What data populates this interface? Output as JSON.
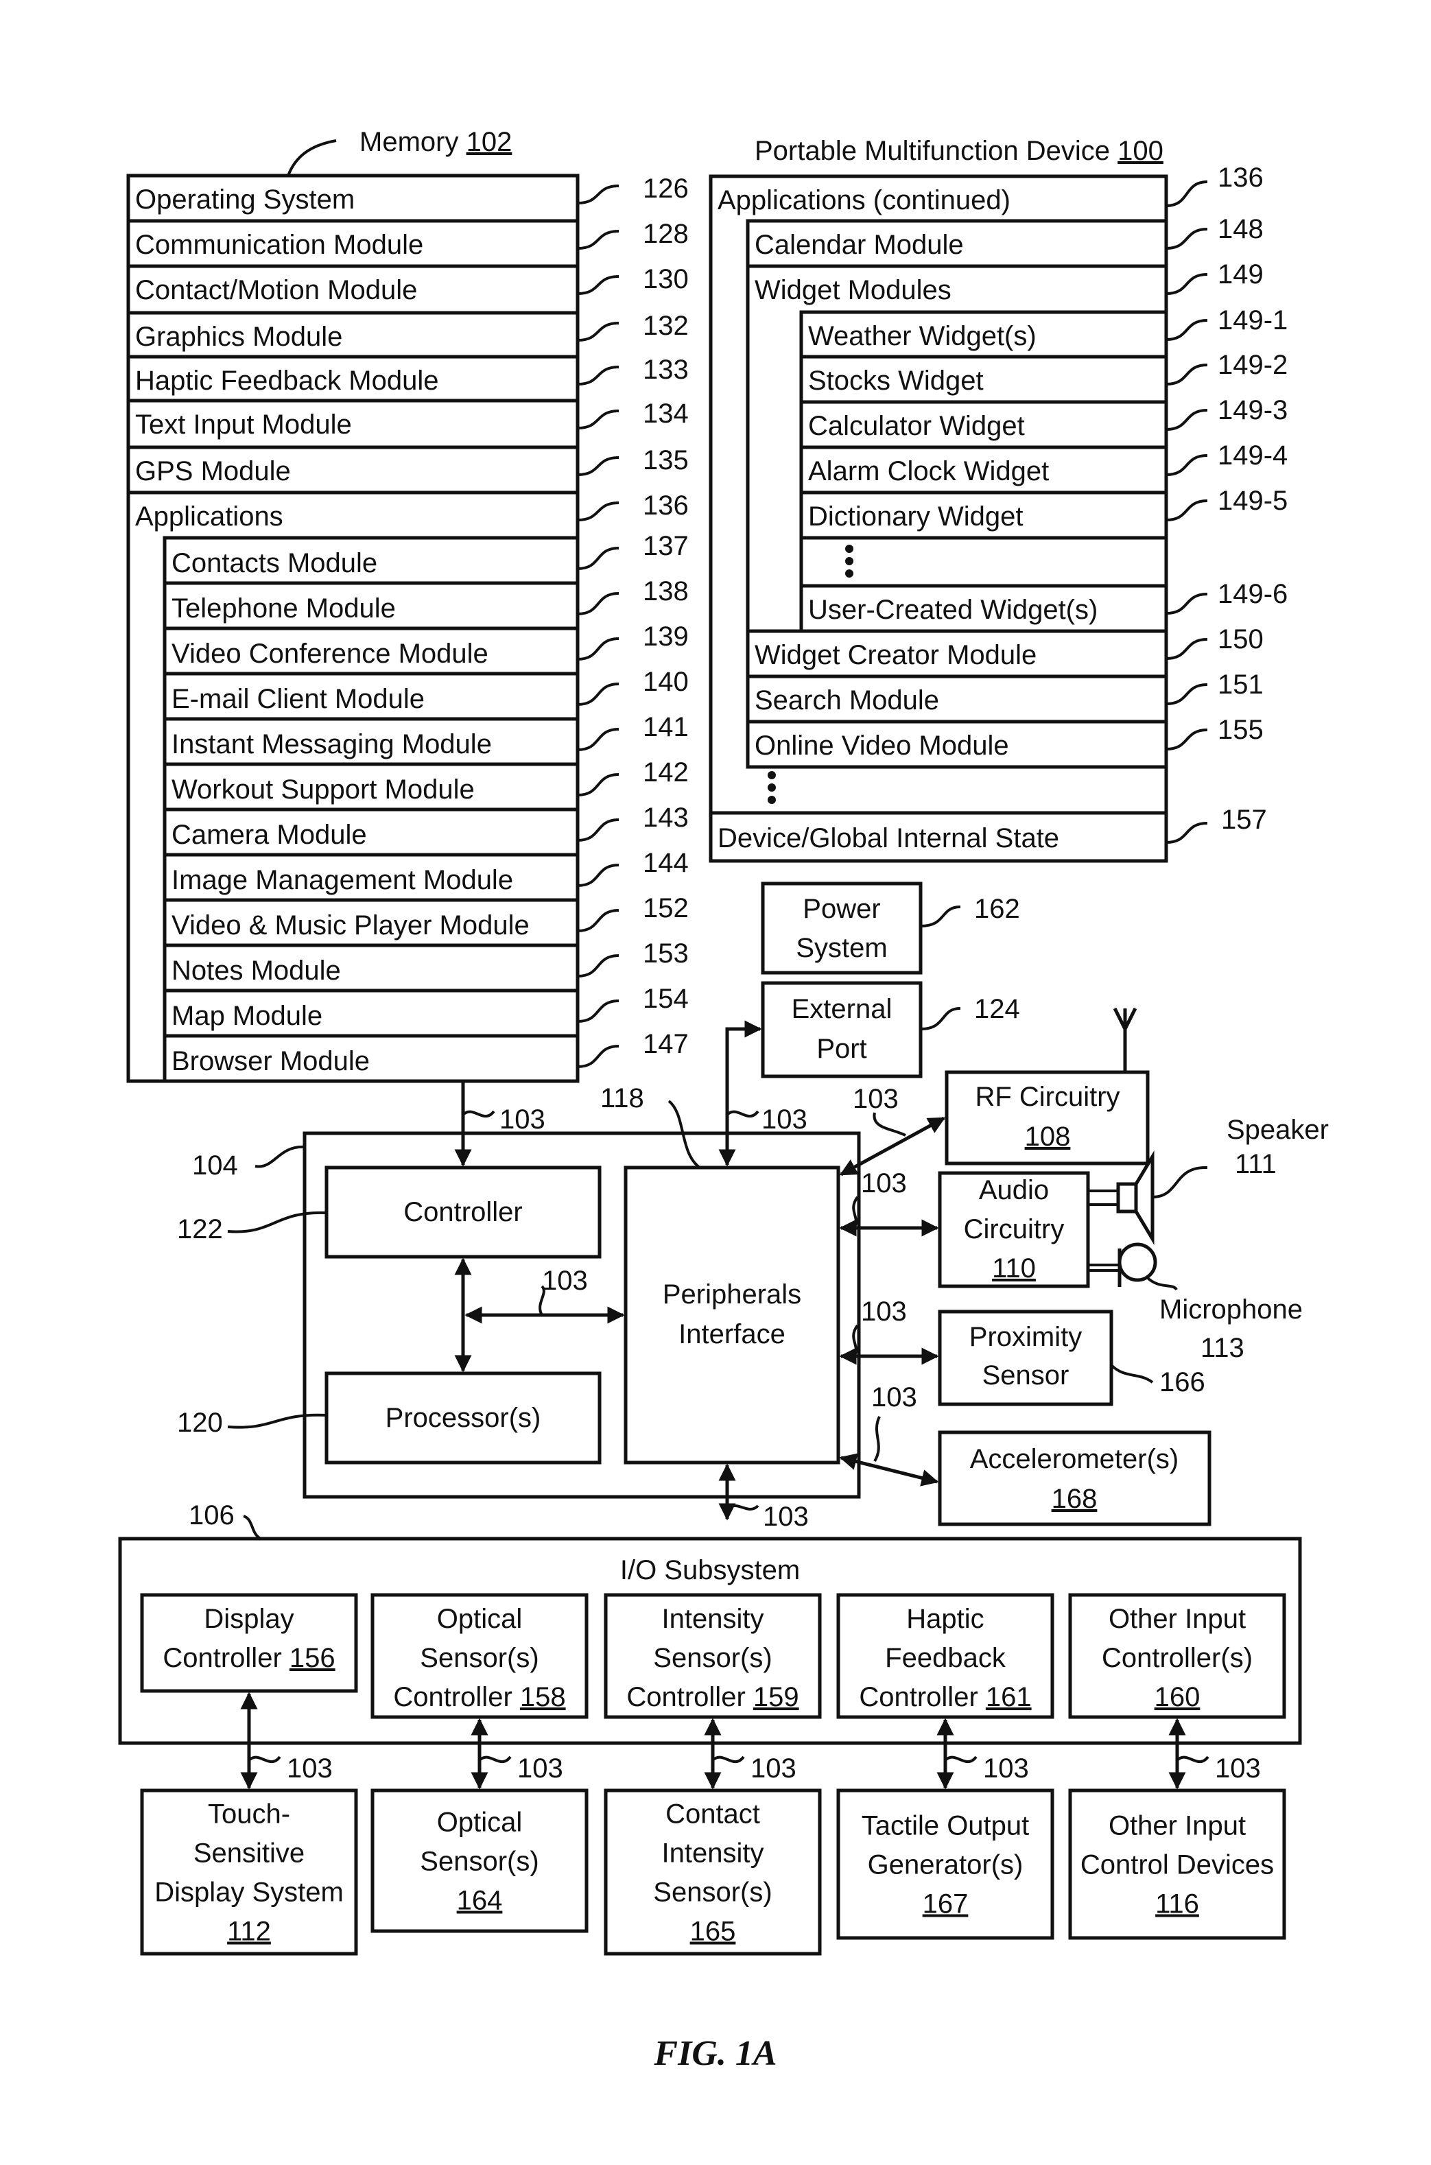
{
  "figure_caption": "FIG. 1A",
  "memory": {
    "title": "Memory",
    "title_ref": "102",
    "items": [
      {
        "label": "Operating System",
        "ref": "126"
      },
      {
        "label": "Communication Module",
        "ref": "128"
      },
      {
        "label": "Contact/Motion Module",
        "ref": "130"
      },
      {
        "label": "Graphics Module",
        "ref": "132"
      },
      {
        "label": "Haptic Feedback Module",
        "ref": "133"
      },
      {
        "label": "Text Input Module",
        "ref": "134"
      },
      {
        "label": "GPS Module",
        "ref": "135"
      },
      {
        "label": "Applications",
        "ref": "136"
      }
    ],
    "applications": [
      {
        "label": "Contacts Module",
        "ref": "137"
      },
      {
        "label": "Telephone Module",
        "ref": "138"
      },
      {
        "label": "Video Conference Module",
        "ref": "139"
      },
      {
        "label": "E-mail Client Module",
        "ref": "140"
      },
      {
        "label": "Instant Messaging Module",
        "ref": "141"
      },
      {
        "label": "Workout Support Module",
        "ref": "142"
      },
      {
        "label": "Camera Module",
        "ref": "143"
      },
      {
        "label": "Image Management Module",
        "ref": "144"
      },
      {
        "label": "Video & Music Player Module",
        "ref": "152"
      },
      {
        "label": "Notes Module",
        "ref": "153"
      },
      {
        "label": "Map Module",
        "ref": "154"
      },
      {
        "label": "Browser Module",
        "ref": "147"
      }
    ]
  },
  "device": {
    "title": "Portable Multifunction Device",
    "title_ref": "100",
    "apps_continued": {
      "label": "Applications (continued)",
      "ref": "136"
    },
    "calendar": {
      "label": "Calendar Module",
      "ref": "148"
    },
    "widget_modules": {
      "label": "Widget Modules",
      "ref": "149"
    },
    "widgets": [
      {
        "label": "Weather Widget(s)",
        "ref": "149-1"
      },
      {
        "label": "Stocks Widget",
        "ref": "149-2"
      },
      {
        "label": "Calculator Widget",
        "ref": "149-3"
      },
      {
        "label": "Alarm Clock Widget",
        "ref": "149-4"
      },
      {
        "label": "Dictionary Widget",
        "ref": "149-5"
      },
      {
        "label": "User-Created Widget(s)",
        "ref": "149-6"
      }
    ],
    "more_modules": [
      {
        "label": "Widget Creator Module",
        "ref": "150"
      },
      {
        "label": "Search Module",
        "ref": "151"
      },
      {
        "label": "Online Video Module",
        "ref": "155"
      }
    ],
    "internal_state": {
      "label": "Device/Global Internal State",
      "ref": "157"
    }
  },
  "power_system": {
    "line1": "Power",
    "line2": "System",
    "ref": "162"
  },
  "external_port": {
    "line1": "External",
    "line2": "Port",
    "ref": "124"
  },
  "chip": {
    "ref": "104",
    "controller": {
      "label": "Controller",
      "ref": "122"
    },
    "processor": {
      "label": "Processor(s)",
      "ref": "120"
    },
    "peripherals": {
      "line1": "Peripherals",
      "line2": "Interface",
      "ref": "118"
    }
  },
  "bus_ref": "103",
  "rf": {
    "label": "RF Circuitry",
    "num": "108"
  },
  "audio": {
    "line1": "Audio",
    "line2": "Circuitry",
    "num": "110"
  },
  "speaker": {
    "label": "Speaker",
    "ref": "111"
  },
  "microphone": {
    "label": "Microphone",
    "ref": "113"
  },
  "proximity": {
    "line1": "Proximity",
    "line2": "Sensor",
    "ref": "166"
  },
  "accelerometer": {
    "label": "Accelerometer(s)",
    "num": "168"
  },
  "io": {
    "title": "I/O Subsystem",
    "ref": "106",
    "controllers": [
      {
        "lines": [
          "Display",
          "Controller"
        ],
        "num": "156"
      },
      {
        "lines": [
          "Optical",
          "Sensor(s)",
          "Controller"
        ],
        "num": "158"
      },
      {
        "lines": [
          "Intensity",
          "Sensor(s)",
          "Controller"
        ],
        "num": "159"
      },
      {
        "lines": [
          "Haptic",
          "Feedback",
          "Controller"
        ],
        "num": "161"
      },
      {
        "lines": [
          "Other Input",
          "Controller(s)"
        ],
        "num": "160"
      }
    ],
    "devices": [
      {
        "lines": [
          "Touch-",
          "Sensitive",
          "Display System"
        ],
        "num": "112"
      },
      {
        "lines": [
          "Optical",
          "Sensor(s)"
        ],
        "num": "164"
      },
      {
        "lines": [
          "Contact",
          "Intensity",
          "Sensor(s)"
        ],
        "num": "165"
      },
      {
        "lines": [
          "Tactile Output",
          "Generator(s)"
        ],
        "num": "167"
      },
      {
        "lines": [
          "Other Input",
          "Control Devices"
        ],
        "num": "116"
      }
    ]
  }
}
